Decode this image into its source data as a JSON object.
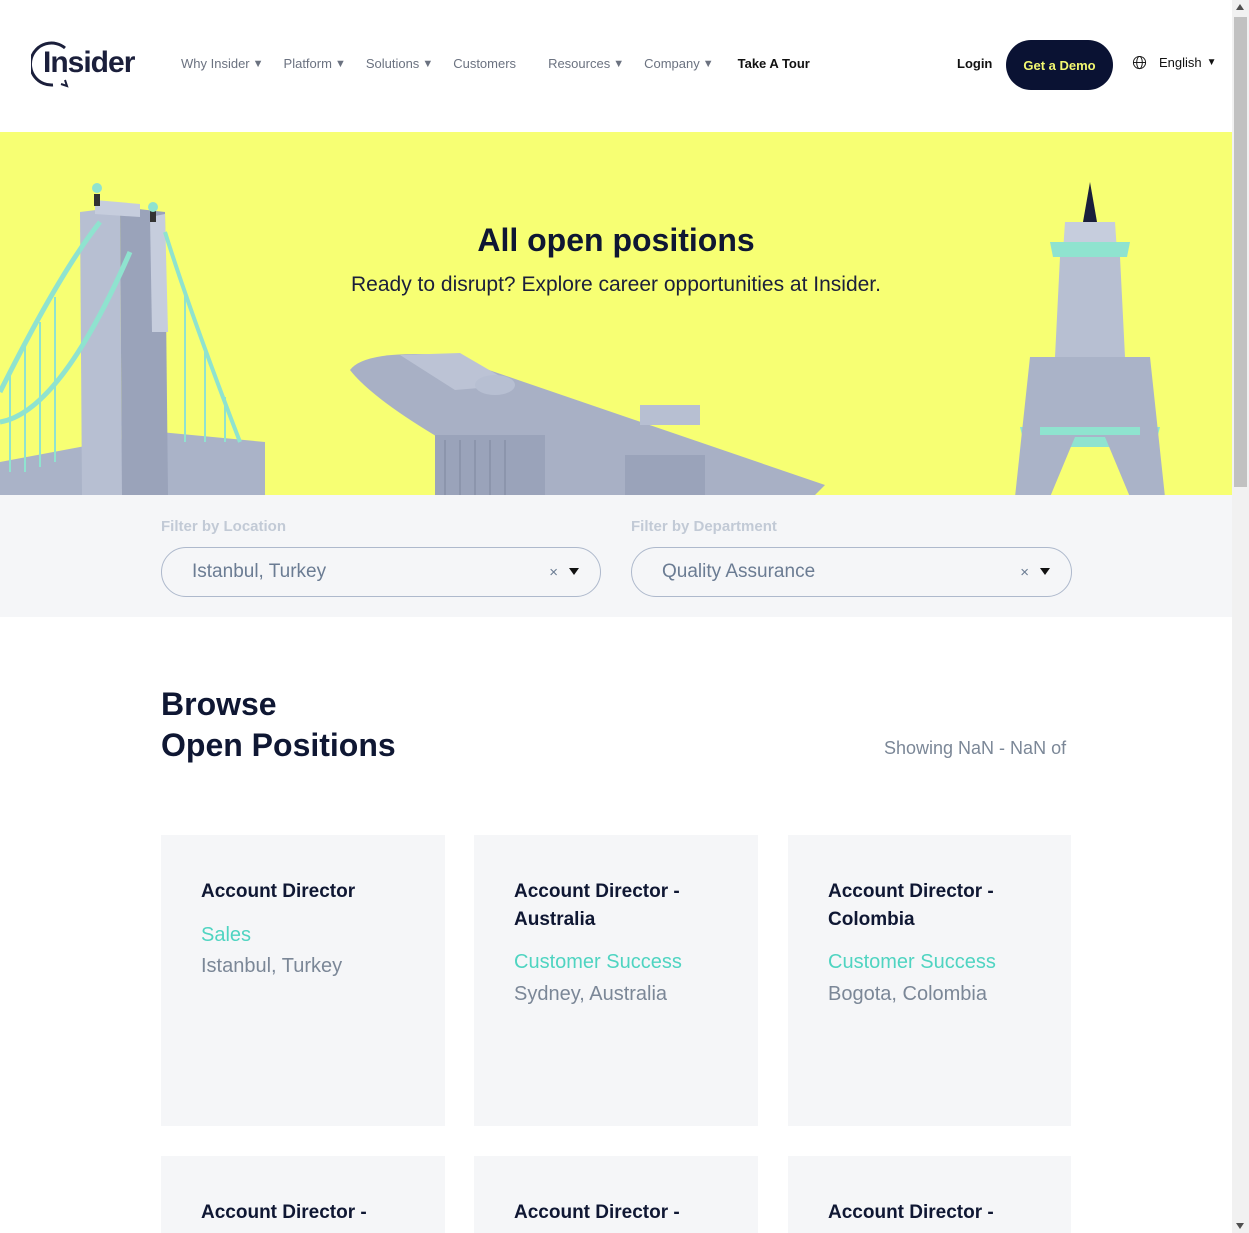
{
  "header": {
    "logo_text": "Insider",
    "nav": [
      {
        "label": "Why Insider",
        "dropdown": true
      },
      {
        "label": "Platform",
        "dropdown": true
      },
      {
        "label": "Solutions",
        "dropdown": true
      },
      {
        "label": "Customers",
        "dropdown": false
      },
      {
        "label": "Resources",
        "dropdown": true
      },
      {
        "label": "Company",
        "dropdown": true
      },
      {
        "label": "Take A Tour",
        "dropdown": false
      }
    ],
    "login_label": "Login",
    "demo_label": "Get a Demo",
    "language": "English"
  },
  "hero": {
    "title": "All open positions",
    "subtitle": "Ready to disrupt? Explore career opportunities at Insider."
  },
  "filters": {
    "location_label": "Filter by Location",
    "location_value": "Istanbul, Turkey",
    "department_label": "Filter by Department",
    "department_value": "Quality Assurance",
    "clear_symbol": "×"
  },
  "browse": {
    "title_line1": "Browse",
    "title_line2": "Open Positions",
    "showing": "Showing NaN - NaN of"
  },
  "positions": [
    {
      "title": "Account Director",
      "department": "Sales",
      "location": "Istanbul, Turkey"
    },
    {
      "title": "Account Director - Australia",
      "department": "Customer Success",
      "location": "Sydney, Australia"
    },
    {
      "title": "Account Director - Colombia",
      "department": "Customer Success",
      "location": "Bogota, Colombia"
    },
    {
      "title": "Account Director -",
      "department": "",
      "location": ""
    },
    {
      "title": "Account Director -",
      "department": "",
      "location": ""
    },
    {
      "title": "Account Director -",
      "department": "",
      "location": ""
    }
  ],
  "colors": {
    "hero_bg": "#f7ff73",
    "dark_navy": "#0a1233",
    "accent_teal": "#4fd4c1",
    "muted_gray": "#7b8797"
  }
}
